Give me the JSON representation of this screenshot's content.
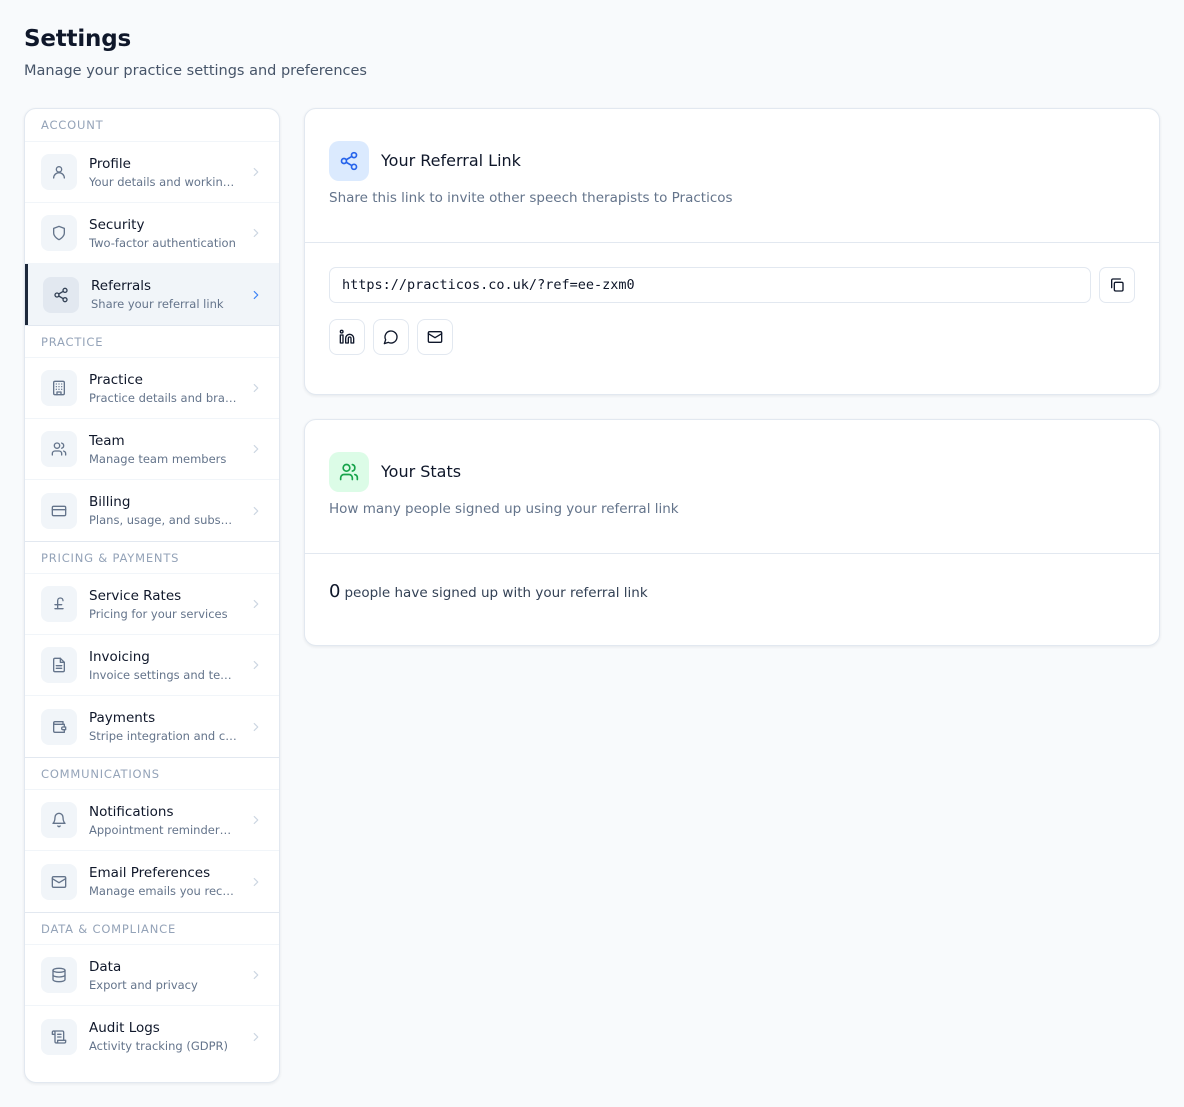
{
  "header": {
    "title": "Settings",
    "subtitle": "Manage your practice settings and preferences"
  },
  "sidebar": {
    "sections": [
      {
        "title": "ACCOUNT",
        "items": [
          {
            "label": "Profile",
            "desc": "Your details and working hours",
            "icon": "user-icon"
          },
          {
            "label": "Security",
            "desc": "Two-factor authentication",
            "icon": "shield-icon"
          },
          {
            "label": "Referrals",
            "desc": "Share your referral link",
            "icon": "share-icon",
            "active": true
          }
        ]
      },
      {
        "title": "PRACTICE",
        "items": [
          {
            "label": "Practice",
            "desc": "Practice details and branding",
            "icon": "building-icon"
          },
          {
            "label": "Team",
            "desc": "Manage team members",
            "icon": "users-icon"
          },
          {
            "label": "Billing",
            "desc": "Plans, usage, and subscription",
            "icon": "credit-card-icon"
          }
        ]
      },
      {
        "title": "PRICING & PAYMENTS",
        "items": [
          {
            "label": "Service Rates",
            "desc": "Pricing for your services",
            "icon": "pound-icon"
          },
          {
            "label": "Invoicing",
            "desc": "Invoice settings and templates",
            "icon": "file-text-icon"
          },
          {
            "label": "Payments",
            "desc": "Stripe integration and card payments",
            "icon": "wallet-icon"
          }
        ]
      },
      {
        "title": "COMMUNICATIONS",
        "items": [
          {
            "label": "Notifications",
            "desc": "Appointment reminders and alerts",
            "icon": "bell-icon"
          },
          {
            "label": "Email Preferences",
            "desc": "Manage emails you receive",
            "icon": "mail-icon"
          }
        ]
      },
      {
        "title": "DATA & COMPLIANCE",
        "items": [
          {
            "label": "Data",
            "desc": "Export and privacy",
            "icon": "database-icon"
          },
          {
            "label": "Audit Logs",
            "desc": "Activity tracking (GDPR)",
            "icon": "scroll-icon"
          }
        ]
      }
    ]
  },
  "referral": {
    "title": "Your Referral Link",
    "desc": "Share this link to invite other speech therapists to Practicos",
    "link": "https://practicos.co.uk/?ref=ee-zxm0",
    "share_buttons": [
      "linkedin-icon",
      "message-circle-icon",
      "mail-icon"
    ]
  },
  "stats": {
    "title": "Your Stats",
    "desc": "How many people signed up using your referral link",
    "count": "0",
    "count_text": "people have signed up with your referral link"
  },
  "colors": {
    "page_bg": "#f8fafc",
    "active_bg": "#f1f5f9",
    "active_border": "#1e293b",
    "accent_blue": "#2563eb",
    "accent_green": "#16a34a"
  }
}
